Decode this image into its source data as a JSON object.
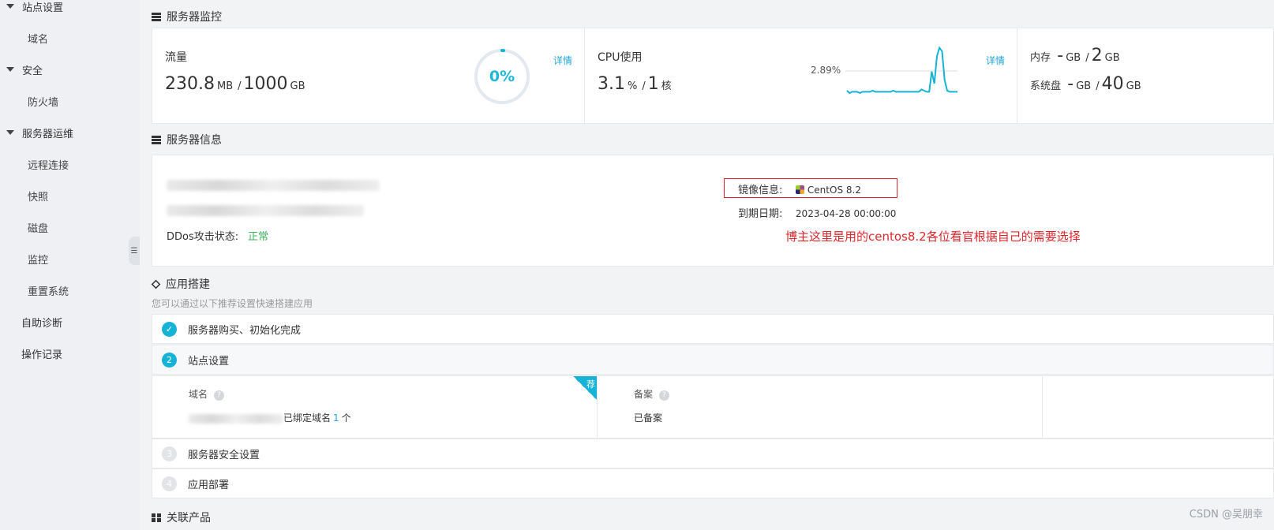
{
  "sidebar": {
    "items": [
      {
        "label": "站点设置",
        "type": "group"
      },
      {
        "label": "域名",
        "type": "sub"
      },
      {
        "label": "安全",
        "type": "group"
      },
      {
        "label": "防火墙",
        "type": "sub"
      },
      {
        "label": "服务器运维",
        "type": "group"
      },
      {
        "label": "远程连接",
        "type": "sub"
      },
      {
        "label": "快照",
        "type": "sub"
      },
      {
        "label": "磁盘",
        "type": "sub"
      },
      {
        "label": "监控",
        "type": "sub"
      },
      {
        "label": "重置系统",
        "type": "sub"
      },
      {
        "label": "自助诊断",
        "type": "top"
      },
      {
        "label": "操作记录",
        "type": "top"
      }
    ],
    "collapse_glyph": "☰"
  },
  "monitor": {
    "title": "服务器监控",
    "traffic": {
      "label": "流量",
      "used": "230.8",
      "used_unit": "MB",
      "sep": "/",
      "total": "1000",
      "total_unit": "GB",
      "gauge_text": "0%",
      "gauge_percent": 0.01,
      "detail": "详情"
    },
    "cpu": {
      "label": "CPU使用",
      "value": "3.1",
      "unit": "%",
      "sep": "/",
      "cores": "1",
      "cores_unit": "核",
      "peak_label": "2.89%",
      "detail": "详情",
      "series": [
        0.6,
        0.4,
        0.5,
        0.5,
        0.5,
        0.4,
        0.5,
        0.5,
        0.5,
        0.5,
        0.6,
        0.5,
        0.5,
        0.5,
        0.5,
        0.5,
        0.5,
        0.5,
        0.6,
        0.5,
        0.5,
        0.5,
        0.5,
        0.5,
        0.5,
        0.5,
        0.5,
        0.5,
        0.5,
        0.7,
        0.6,
        0.5,
        0.5,
        2.2,
        1.2,
        3.5,
        4.2,
        3.9,
        1.5,
        0.6,
        0.5,
        0.5,
        0.5,
        0.5
      ]
    },
    "memory": {
      "label": "内存",
      "used": "-",
      "used_unit": "GB",
      "sep": "/",
      "total": "2",
      "total_unit": "GB"
    },
    "disk": {
      "label": "系统盘",
      "used": "-",
      "used_unit": "GB",
      "sep": "/",
      "total": "40",
      "total_unit": "GB"
    }
  },
  "server_info": {
    "title": "服务器信息",
    "ddos_label": "DDos攻击状态:",
    "ddos_value": "正常",
    "mirror_label": "镜像信息:",
    "mirror_value": "CentOS 8.2",
    "expire_label": "到期日期:",
    "expire_value": "2023-04-28 00:00:00",
    "note": "博主这里是用的centos8.2各位看官根据自己的需要选择"
  },
  "app_build": {
    "title": "应用搭建",
    "hint": "您可以通过以下推荐设置快速搭建应用",
    "steps": [
      {
        "num": "✓",
        "label": "服务器购买、初始化完成",
        "state": "done"
      },
      {
        "num": "2",
        "label": "站点设置",
        "state": "active"
      },
      {
        "num": "3",
        "label": "服务器安全设置",
        "state": "todo"
      },
      {
        "num": "4",
        "label": "应用部署",
        "state": "todo"
      }
    ],
    "site": {
      "domain_label": "域名",
      "domain_bound_prefix": "已绑定域名",
      "domain_count": "1",
      "domain_bound_suffix": "个",
      "recommend": "荐",
      "icp_label": "备案",
      "icp_value": "已备案"
    }
  },
  "related": {
    "title": "关联产品"
  },
  "watermark": "CSDN @吴朋幸",
  "colors": {
    "accent": "#17b3d6",
    "link": "#1fa6d9",
    "ok": "#3bb25a",
    "annotation": "#e0262b"
  }
}
